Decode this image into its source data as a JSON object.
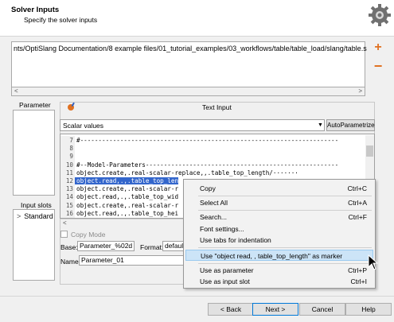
{
  "header": {
    "title": "Solver Inputs",
    "subtitle": "Specify the solver inputs"
  },
  "path_panel": {
    "path": "nts/OptiSlang Documentation/8 example files/01_tutorial_examples/03_workflows/table/table_load/slang/table.s"
  },
  "left": {
    "parameter_label": "Parameter",
    "input_slots_label": "Input slots",
    "slot_item": "Standard"
  },
  "text_input": {
    "title": "Text Input",
    "combo_value": "Scalar values",
    "autoparam_label": "AutoParametrize",
    "lines": [
      {
        "num": "7",
        "text": "#-----------------------------------------------------------------------",
        "selected": false
      },
      {
        "num": "8",
        "text": "",
        "selected": false
      },
      {
        "num": "9",
        "text": "",
        "selected": false
      },
      {
        "num": "10",
        "text": "#--Model-Parameters-----------------------------------------------------",
        "selected": false
      },
      {
        "num": "11",
        "text": "object.create,.real-scalar-replace,,.table_top_length/·······",
        "selected": false
      },
      {
        "num": "12",
        "text": "object.read,.,.table_top_len",
        "selected": true
      },
      {
        "num": "13",
        "text": "object.create,.real-scalar-r",
        "selected": false
      },
      {
        "num": "14",
        "text": "object.read,.,.table_top_wid",
        "selected": false
      },
      {
        "num": "15",
        "text": "object.create,.real-scalar-r",
        "selected": false
      },
      {
        "num": "16",
        "text": "object.read,.,.table_top_hei",
        "selected": false
      }
    ]
  },
  "copy_mode": {
    "label": "Copy Mode",
    "checked": false
  },
  "fields": {
    "base_label": "Base:",
    "base_value": "Parameter_%02d",
    "format_label": "Format:",
    "format_value": "defaul",
    "name_label": "Name:",
    "name_value": "Parameter_01"
  },
  "context_menu": {
    "items": [
      {
        "label": "Copy",
        "shortcut": "Ctrl+C"
      },
      {
        "label": "Select All",
        "shortcut": "Ctrl+A"
      },
      {
        "label": "Search...",
        "shortcut": "Ctrl+F"
      },
      {
        "label": "Font settings...",
        "shortcut": ""
      },
      {
        "label": "Use tabs for indentation",
        "shortcut": ""
      },
      {
        "label": "Use \"object read, , table_top_length\" as marker",
        "shortcut": ""
      },
      {
        "label": "Use as parameter",
        "shortcut": "Ctrl+P"
      },
      {
        "label": "Use as input slot",
        "shortcut": "Ctrl+I"
      }
    ]
  },
  "buttons": {
    "back": "< Back",
    "next": "Next >",
    "cancel": "Cancel",
    "help": "Help"
  },
  "colors": {
    "accent_orange": "#e07020",
    "selection_blue": "#3366cc",
    "menu_highlight": "#cce4f7"
  }
}
